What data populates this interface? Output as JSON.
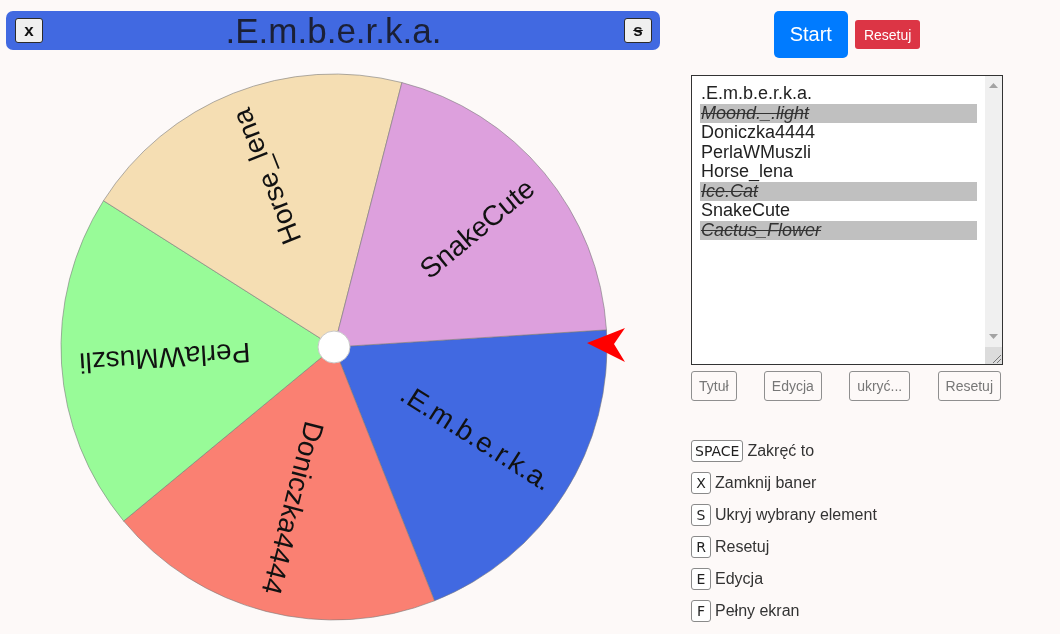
{
  "banner": {
    "buttons": [
      {
        "label": "x",
        "kind": "close"
      },
      {
        "label": "s",
        "kind": "hide"
      }
    ],
    "title": ".E.m.b.e.r.k.a."
  },
  "wheel": {
    "segments": [
      {
        "label": ".E.m.b.e.r.k.a.",
        "color": "#4169e1"
      },
      {
        "label": "Doniczka4444",
        "color": "#fa8072"
      },
      {
        "label": "PerlaWMuszli",
        "color": "#98fb98"
      },
      {
        "label": "Horse_lena",
        "color": "#f5deb3"
      },
      {
        "label": "SnakeCute",
        "color": "#dda0dd"
      }
    ]
  },
  "actions": [
    {
      "label": "Start",
      "kind": "primary"
    },
    {
      "label": "Resetuj",
      "kind": "danger"
    }
  ],
  "entries": [
    {
      "text": ".E.m.b.e.r.k.a.",
      "hidden": false
    },
    {
      "text": "Moond._.light",
      "hidden": true
    },
    {
      "text": "Doniczka4444",
      "hidden": false
    },
    {
      "text": "PerlaWMuszli",
      "hidden": false
    },
    {
      "text": "Horse_lena",
      "hidden": false
    },
    {
      "text": "Ice.Cat",
      "hidden": true
    },
    {
      "text": "SnakeCute",
      "hidden": false
    },
    {
      "text": "Cactus_Flower",
      "hidden": true
    }
  ],
  "entry_buttons": [
    "Tytuł",
    "Edycja",
    "ukryć...",
    "Resetuj"
  ],
  "shortcuts": [
    {
      "key": "SPACE",
      "label": "Zakręć to"
    },
    {
      "key": "X",
      "label": "Zamknij baner"
    },
    {
      "key": "S",
      "label": "Ukryj wybrany element"
    },
    {
      "key": "R",
      "label": "Resetuj"
    },
    {
      "key": "E",
      "label": "Edycja"
    },
    {
      "key": "F",
      "label": "Pełny ekran"
    }
  ]
}
